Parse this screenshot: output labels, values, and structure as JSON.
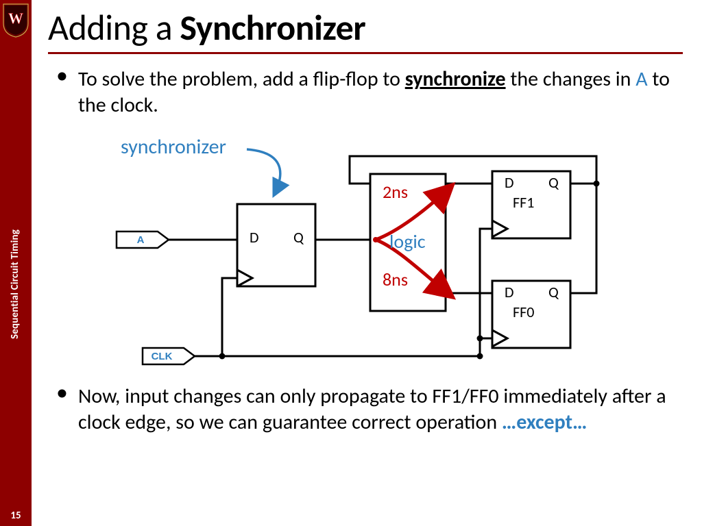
{
  "sidebar": {
    "course_title": "Sequential Circuit Timing",
    "page_number": "15"
  },
  "title": {
    "pre": "Adding a ",
    "strong": "Synchronizer"
  },
  "bullet1": {
    "pre": "To solve the problem, add a flip-flop to ",
    "sync": "synchronize",
    "mid": " the changes in ",
    "A": "A",
    "post": " to the clock."
  },
  "bullet2": {
    "text": "Now, input changes can only propagate to FF1/FF0 immediately after a clock edge, so we can guarantee correct operation   ",
    "except": "…except…"
  },
  "diagram": {
    "synchronizer_label": "synchronizer",
    "logic_label": "logic",
    "delay_top": "2ns",
    "delay_bottom": "8ns",
    "ff1": "FF1",
    "ff0": "FF0",
    "input_signal": "A",
    "clock_signal": "CLK",
    "port_D": "D",
    "port_Q": "Q"
  }
}
